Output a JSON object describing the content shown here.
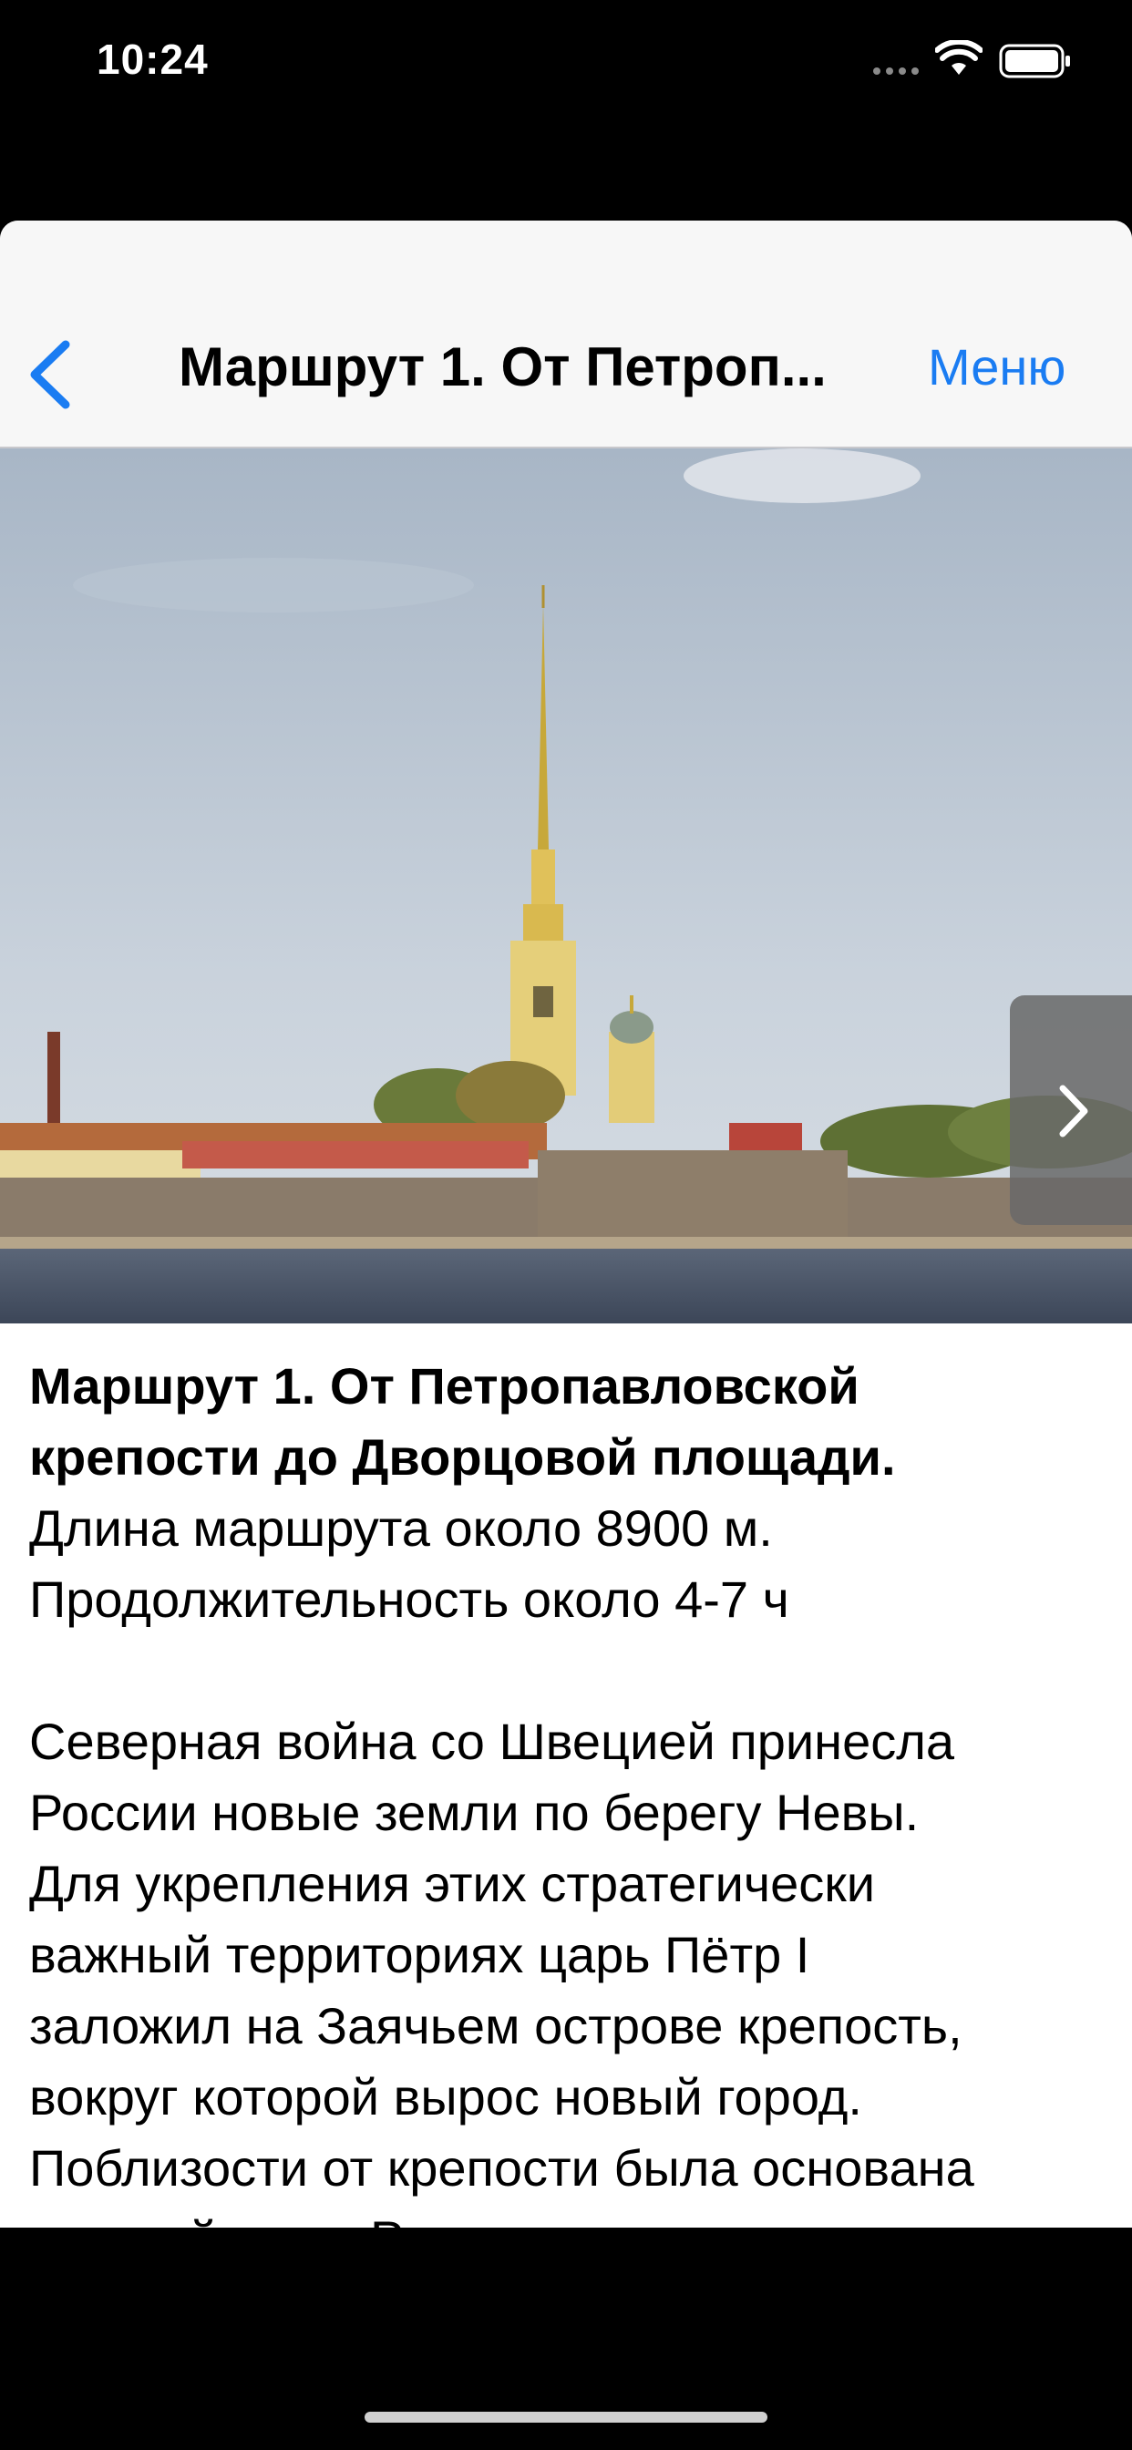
{
  "status_bar": {
    "time": "10:24"
  },
  "nav": {
    "title": "Маршрут 1. От Петроп...",
    "menu_label": "Меню"
  },
  "article": {
    "heading_line1": "Маршрут 1.  От Петропавловской",
    "heading_line2": "крепости до Дворцовой площади.",
    "length": "Длина маршрута около 8900 м.",
    "duration": "Продолжительность около 4-7 ч",
    "body_lines": [
      "Северная война со Швецией принесла",
      "России новые земли по берегу Невы.",
      "Для укрепления этих стратегически",
      "важный территориях царь Пётр I",
      "заложил на Заячьем острове крепость,",
      "вокруг которой вырос новый город.",
      "Поблизости от крепости была основана",
      "крупнейшая в России судостроительную"
    ]
  },
  "colors": {
    "accent": "#1a7cf2",
    "nav_bg": "#f7f7f7"
  }
}
